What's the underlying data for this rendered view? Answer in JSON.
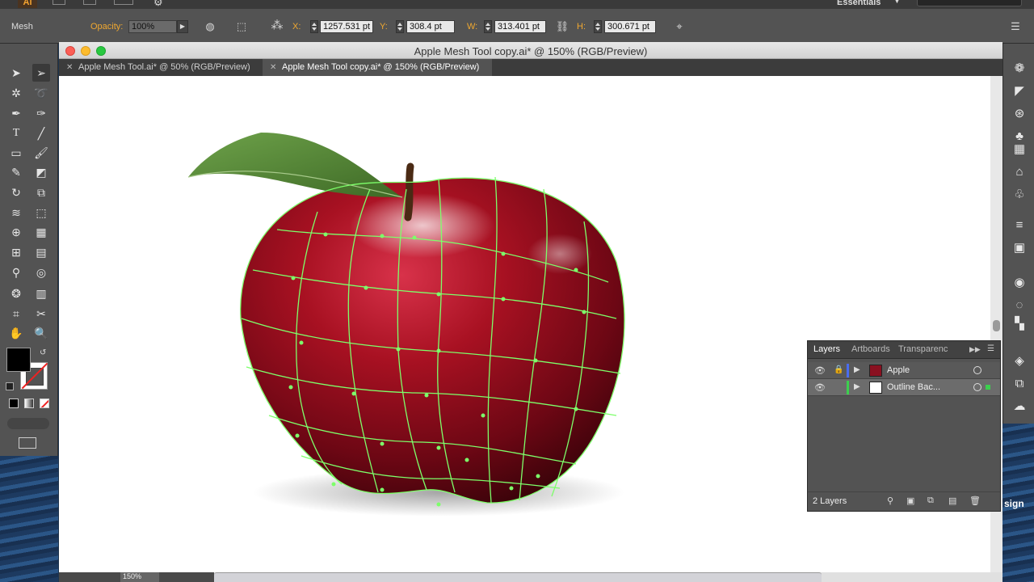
{
  "app": {
    "logo_text": "Ai",
    "workspace": "Essentials"
  },
  "control_bar": {
    "selection_label": "Mesh",
    "opacity_label": "Opacity:",
    "opacity_value": "100%",
    "x_label": "X:",
    "x_value": "1257.531 pt",
    "y_label": "Y:",
    "y_value": "308.4 pt",
    "w_label": "W:",
    "w_value": "313.401 pt",
    "h_label": "H:",
    "h_value": "300.671 pt"
  },
  "document": {
    "title": "Apple Mesh Tool copy.ai* @ 150% (RGB/Preview)",
    "tabs": [
      {
        "label": "Apple Mesh Tool.ai* @ 50% (RGB/Preview)",
        "active": false
      },
      {
        "label": "Apple Mesh Tool copy.ai* @ 150% (RGB/Preview)",
        "active": true
      }
    ],
    "zoom": "150%"
  },
  "layers_panel": {
    "tabs": [
      "Layers",
      "Artboards",
      "Transparenc"
    ],
    "rows": [
      {
        "name": "Apple",
        "color": "#4a6cf0",
        "selected": false
      },
      {
        "name": "Outline Bac...",
        "color": "#3ccf4e",
        "selected": true
      }
    ],
    "count_label": "2 Layers"
  },
  "desktop": {
    "partial_text": "sign"
  },
  "colors": {
    "mesh": "#7dff6a",
    "apple_dark": "#5a0612",
    "apple_mid": "#9d1020",
    "leaf": "#5c8a3a"
  },
  "icons": {
    "tools": [
      "selection-arrow-icon",
      "direct-selection-icon",
      "magic-wand-icon",
      "lasso-icon",
      "pen-icon",
      "curvature-pen-icon",
      "type-icon",
      "line-segment-icon",
      "rectangle-icon",
      "paintbrush-icon",
      "pencil-icon",
      "eraser-icon",
      "rotate-icon",
      "scale-icon",
      "width-icon",
      "free-transform-icon",
      "shape-builder-icon",
      "perspective-grid-icon",
      "mesh-icon",
      "gradient-icon",
      "eyedropper-icon",
      "blend-icon",
      "symbol-sprayer-icon",
      "column-graph-icon",
      "artboard-icon",
      "slice-icon",
      "hand-icon",
      "zoom-icon"
    ]
  }
}
